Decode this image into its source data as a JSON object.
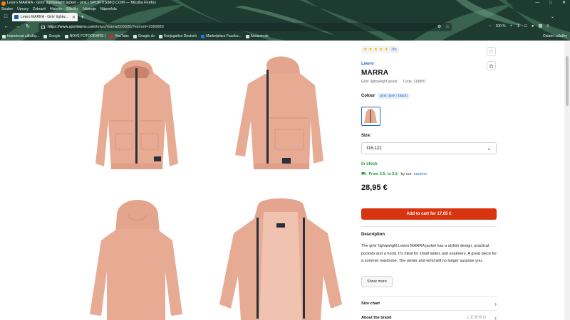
{
  "browser": {
    "window_title": "Lewro MARRA - Girls' lightweight jacket - pink | SPORTISIMO.COM — Mozilla Firefox",
    "menu": [
      "Soubor",
      "Úpravy",
      "Zobrazit",
      "Historie",
      "Záložky",
      "Nástroje",
      "Nápověda"
    ],
    "tab_label": "Lewro MARRA - Girls' lightweight jac",
    "url_host": "https://www.sportisimo.com",
    "url_path": "/lewro/marra/506835/?variant=2089889",
    "zoom": "100 %",
    "bookmarks": [
      "Importovat záložky...",
      "Google",
      "NOVÉ FOTOGRAFIE |",
      "YouTube",
      "Google do",
      "Konjugation Deutsch",
      "Marketplace Facebo...",
      "Amazon.de"
    ],
    "other_bookmarks": "Ostatní záložky"
  },
  "product": {
    "rating_count": "25x",
    "brand": "Lewro",
    "name": "MARRA",
    "subtitle": "Girls' lightweight jacket",
    "code": "Code: 118850",
    "colour_label": "Colour",
    "colour_value": "pink (pink / black)",
    "size_label": "Size:",
    "size_value": "116-122",
    "stock": "In stock",
    "delivery_dates": "From 2.5. to 5.5.",
    "delivery_by": "by our",
    "delivery_link": "carriers",
    "price": "28,95 €",
    "add_to_cart": "Add to cart for 17,05 €",
    "description_title": "Description",
    "description": "The girls' lightweight Lewro MARRA jacket has a stylish design, practical pockets and a hood. It's ideal for small ladies and explorers. A great piece for a summer wardrobe. The winter and wind will no longer surprise you.",
    "show_more": "Show more",
    "size_chart": "Size chart",
    "about_brand": "About the brand",
    "brand_logo_text": "LEWRO"
  },
  "colors": {
    "jacket_pink": "#e7ab94",
    "accent_blue": "#1f66d1",
    "cart_red": "#d8340f",
    "stock_green": "#1f9b3a"
  },
  "icons": {
    "wishlist": "heart-icon",
    "compare": "compare-icon",
    "delivery": "truck-icon"
  }
}
